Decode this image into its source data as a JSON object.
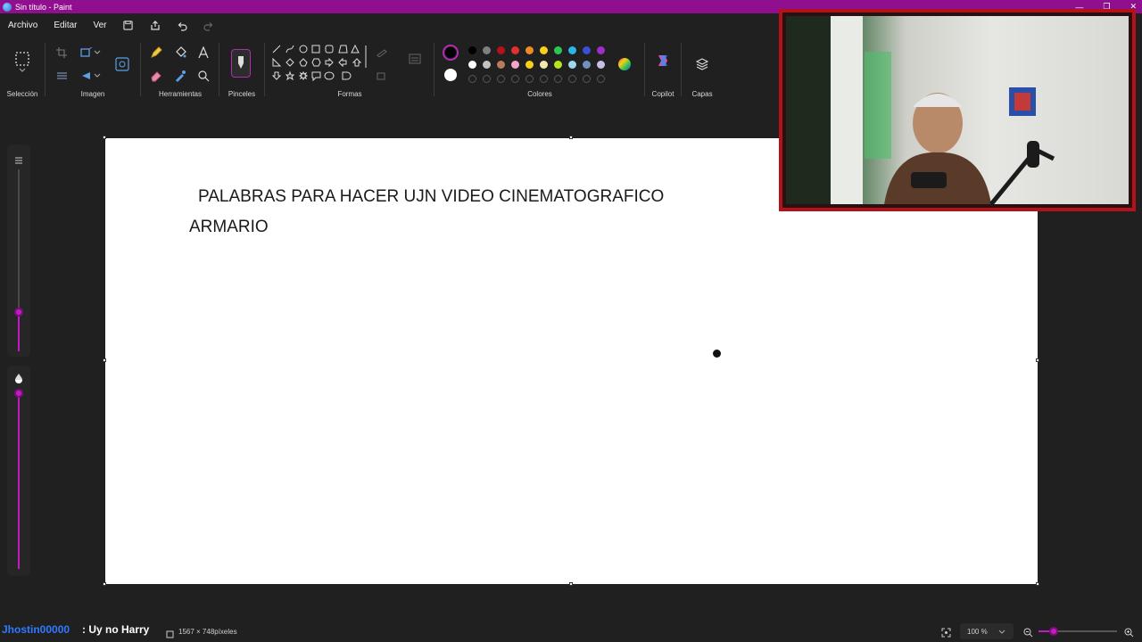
{
  "window": {
    "title": "Sin título - Paint"
  },
  "menu": {
    "file": "Archivo",
    "edit": "Editar",
    "view": "Ver"
  },
  "ribbon": {
    "selection": "Selección",
    "image": "Imagen",
    "tools": "Herramientas",
    "brushes": "Pinceles",
    "shapes": "Formas",
    "colors": "Colores",
    "copilot": "Copilot",
    "layers": "Capas"
  },
  "palette": {
    "primary": "#000000",
    "secondary": "#ffffff",
    "row1": [
      "#000000",
      "#7f7f7f",
      "#b5121b",
      "#e03030",
      "#f08a24",
      "#f7d019",
      "#2fc553",
      "#2bb6e8",
      "#3a4fd6",
      "#9e2fc4"
    ],
    "row2": [
      "#ffffff",
      "#c3c3c3",
      "#b87b5b",
      "#f5a3c7",
      "#f7d019",
      "#f2e8b0",
      "#b5e61d",
      "#99d9ea",
      "#7092be",
      "#c8bfe7"
    ]
  },
  "canvas": {
    "line1": "PALABRAS PARA HACER UJN VIDEO CINEMATOGRAFICO",
    "line2": "ARMARIO"
  },
  "status": {
    "size": "1567 × 748píxeles",
    "zoom": "100 %",
    "overlay_user": "Jhostin00000",
    "overlay_text": ": Uy no Harry"
  }
}
